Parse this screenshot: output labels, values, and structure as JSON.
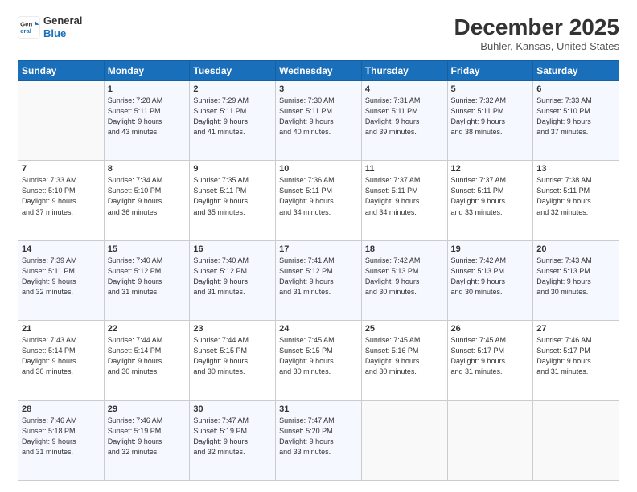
{
  "logo": {
    "line1": "General",
    "line2": "Blue"
  },
  "header": {
    "title": "December 2025",
    "subtitle": "Buhler, Kansas, United States"
  },
  "days_of_week": [
    "Sunday",
    "Monday",
    "Tuesday",
    "Wednesday",
    "Thursday",
    "Friday",
    "Saturday"
  ],
  "weeks": [
    [
      {
        "day": null,
        "info": []
      },
      {
        "day": "1",
        "info": [
          "Sunrise: 7:28 AM",
          "Sunset: 5:11 PM",
          "Daylight: 9 hours",
          "and 43 minutes."
        ]
      },
      {
        "day": "2",
        "info": [
          "Sunrise: 7:29 AM",
          "Sunset: 5:11 PM",
          "Daylight: 9 hours",
          "and 41 minutes."
        ]
      },
      {
        "day": "3",
        "info": [
          "Sunrise: 7:30 AM",
          "Sunset: 5:11 PM",
          "Daylight: 9 hours",
          "and 40 minutes."
        ]
      },
      {
        "day": "4",
        "info": [
          "Sunrise: 7:31 AM",
          "Sunset: 5:11 PM",
          "Daylight: 9 hours",
          "and 39 minutes."
        ]
      },
      {
        "day": "5",
        "info": [
          "Sunrise: 7:32 AM",
          "Sunset: 5:11 PM",
          "Daylight: 9 hours",
          "and 38 minutes."
        ]
      },
      {
        "day": "6",
        "info": [
          "Sunrise: 7:33 AM",
          "Sunset: 5:10 PM",
          "Daylight: 9 hours",
          "and 37 minutes."
        ]
      }
    ],
    [
      {
        "day": "7",
        "info": [
          "Sunrise: 7:33 AM",
          "Sunset: 5:10 PM",
          "Daylight: 9 hours",
          "and 37 minutes."
        ]
      },
      {
        "day": "8",
        "info": [
          "Sunrise: 7:34 AM",
          "Sunset: 5:10 PM",
          "Daylight: 9 hours",
          "and 36 minutes."
        ]
      },
      {
        "day": "9",
        "info": [
          "Sunrise: 7:35 AM",
          "Sunset: 5:11 PM",
          "Daylight: 9 hours",
          "and 35 minutes."
        ]
      },
      {
        "day": "10",
        "info": [
          "Sunrise: 7:36 AM",
          "Sunset: 5:11 PM",
          "Daylight: 9 hours",
          "and 34 minutes."
        ]
      },
      {
        "day": "11",
        "info": [
          "Sunrise: 7:37 AM",
          "Sunset: 5:11 PM",
          "Daylight: 9 hours",
          "and 34 minutes."
        ]
      },
      {
        "day": "12",
        "info": [
          "Sunrise: 7:37 AM",
          "Sunset: 5:11 PM",
          "Daylight: 9 hours",
          "and 33 minutes."
        ]
      },
      {
        "day": "13",
        "info": [
          "Sunrise: 7:38 AM",
          "Sunset: 5:11 PM",
          "Daylight: 9 hours",
          "and 32 minutes."
        ]
      }
    ],
    [
      {
        "day": "14",
        "info": [
          "Sunrise: 7:39 AM",
          "Sunset: 5:11 PM",
          "Daylight: 9 hours",
          "and 32 minutes."
        ]
      },
      {
        "day": "15",
        "info": [
          "Sunrise: 7:40 AM",
          "Sunset: 5:12 PM",
          "Daylight: 9 hours",
          "and 31 minutes."
        ]
      },
      {
        "day": "16",
        "info": [
          "Sunrise: 7:40 AM",
          "Sunset: 5:12 PM",
          "Daylight: 9 hours",
          "and 31 minutes."
        ]
      },
      {
        "day": "17",
        "info": [
          "Sunrise: 7:41 AM",
          "Sunset: 5:12 PM",
          "Daylight: 9 hours",
          "and 31 minutes."
        ]
      },
      {
        "day": "18",
        "info": [
          "Sunrise: 7:42 AM",
          "Sunset: 5:13 PM",
          "Daylight: 9 hours",
          "and 30 minutes."
        ]
      },
      {
        "day": "19",
        "info": [
          "Sunrise: 7:42 AM",
          "Sunset: 5:13 PM",
          "Daylight: 9 hours",
          "and 30 minutes."
        ]
      },
      {
        "day": "20",
        "info": [
          "Sunrise: 7:43 AM",
          "Sunset: 5:13 PM",
          "Daylight: 9 hours",
          "and 30 minutes."
        ]
      }
    ],
    [
      {
        "day": "21",
        "info": [
          "Sunrise: 7:43 AM",
          "Sunset: 5:14 PM",
          "Daylight: 9 hours",
          "and 30 minutes."
        ]
      },
      {
        "day": "22",
        "info": [
          "Sunrise: 7:44 AM",
          "Sunset: 5:14 PM",
          "Daylight: 9 hours",
          "and 30 minutes."
        ]
      },
      {
        "day": "23",
        "info": [
          "Sunrise: 7:44 AM",
          "Sunset: 5:15 PM",
          "Daylight: 9 hours",
          "and 30 minutes."
        ]
      },
      {
        "day": "24",
        "info": [
          "Sunrise: 7:45 AM",
          "Sunset: 5:15 PM",
          "Daylight: 9 hours",
          "and 30 minutes."
        ]
      },
      {
        "day": "25",
        "info": [
          "Sunrise: 7:45 AM",
          "Sunset: 5:16 PM",
          "Daylight: 9 hours",
          "and 30 minutes."
        ]
      },
      {
        "day": "26",
        "info": [
          "Sunrise: 7:45 AM",
          "Sunset: 5:17 PM",
          "Daylight: 9 hours",
          "and 31 minutes."
        ]
      },
      {
        "day": "27",
        "info": [
          "Sunrise: 7:46 AM",
          "Sunset: 5:17 PM",
          "Daylight: 9 hours",
          "and 31 minutes."
        ]
      }
    ],
    [
      {
        "day": "28",
        "info": [
          "Sunrise: 7:46 AM",
          "Sunset: 5:18 PM",
          "Daylight: 9 hours",
          "and 31 minutes."
        ]
      },
      {
        "day": "29",
        "info": [
          "Sunrise: 7:46 AM",
          "Sunset: 5:19 PM",
          "Daylight: 9 hours",
          "and 32 minutes."
        ]
      },
      {
        "day": "30",
        "info": [
          "Sunrise: 7:47 AM",
          "Sunset: 5:19 PM",
          "Daylight: 9 hours",
          "and 32 minutes."
        ]
      },
      {
        "day": "31",
        "info": [
          "Sunrise: 7:47 AM",
          "Sunset: 5:20 PM",
          "Daylight: 9 hours",
          "and 33 minutes."
        ]
      },
      {
        "day": null,
        "info": []
      },
      {
        "day": null,
        "info": []
      },
      {
        "day": null,
        "info": []
      }
    ]
  ]
}
